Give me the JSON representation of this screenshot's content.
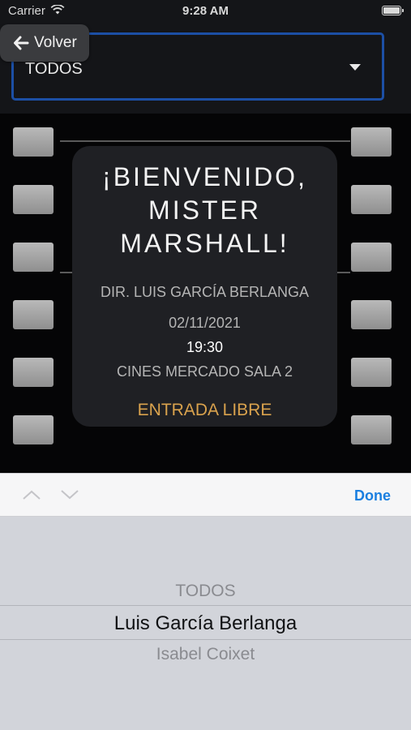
{
  "status_bar": {
    "carrier": "Carrier",
    "time": "9:28 AM"
  },
  "nav": {
    "back_label": "Volver"
  },
  "filter": {
    "selected": "TODOS"
  },
  "event": {
    "title_line1": "¡BIENVENIDO,",
    "title_line2": "MISTER",
    "title_line3": "MARSHALL!",
    "director": "DIR. LUIS GARCÍA BERLANGA",
    "date": "02/11/2021",
    "time": "19:30",
    "venue": "CINES MERCADO SALA 2",
    "price": "ENTRADA LIBRE"
  },
  "toolbar": {
    "done_label": "Done"
  },
  "picker": {
    "items": [
      "TODOS",
      "Luis García Berlanga",
      "Isabel Coixet"
    ],
    "selected_index": 1
  },
  "colors": {
    "accent": "#1c4fa5",
    "price": "#d9a24d",
    "done": "#1a7fe0"
  }
}
